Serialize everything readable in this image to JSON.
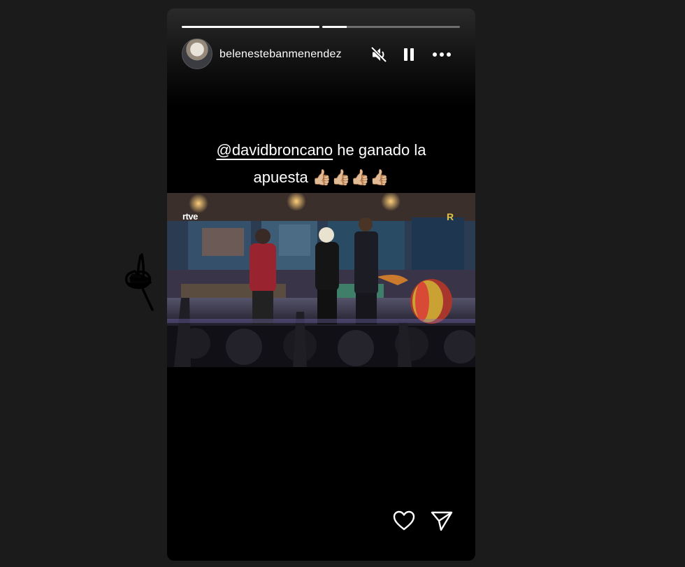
{
  "story": {
    "progress": [
      1.0,
      0.18
    ],
    "username": "belenestebanmenendez",
    "controls": {
      "mute_icon": "speaker-muted-icon",
      "pause_icon": "pause-icon",
      "more_icon": "more-horizontal-icon"
    },
    "caption": {
      "mention": "@davidbroncano",
      "line1_text": " he ganado la",
      "line2_text": "apuesta 👍🏼👍🏼👍🏼👍🏼"
    },
    "video": {
      "channel_logo": "rtve",
      "corner_mark": "R"
    },
    "footer": {
      "like_icon": "heart-icon",
      "share_icon": "send-icon"
    }
  },
  "colors": {
    "page_background": "#1b1b1b",
    "story_background": "#000000",
    "text": "#ffffff"
  }
}
